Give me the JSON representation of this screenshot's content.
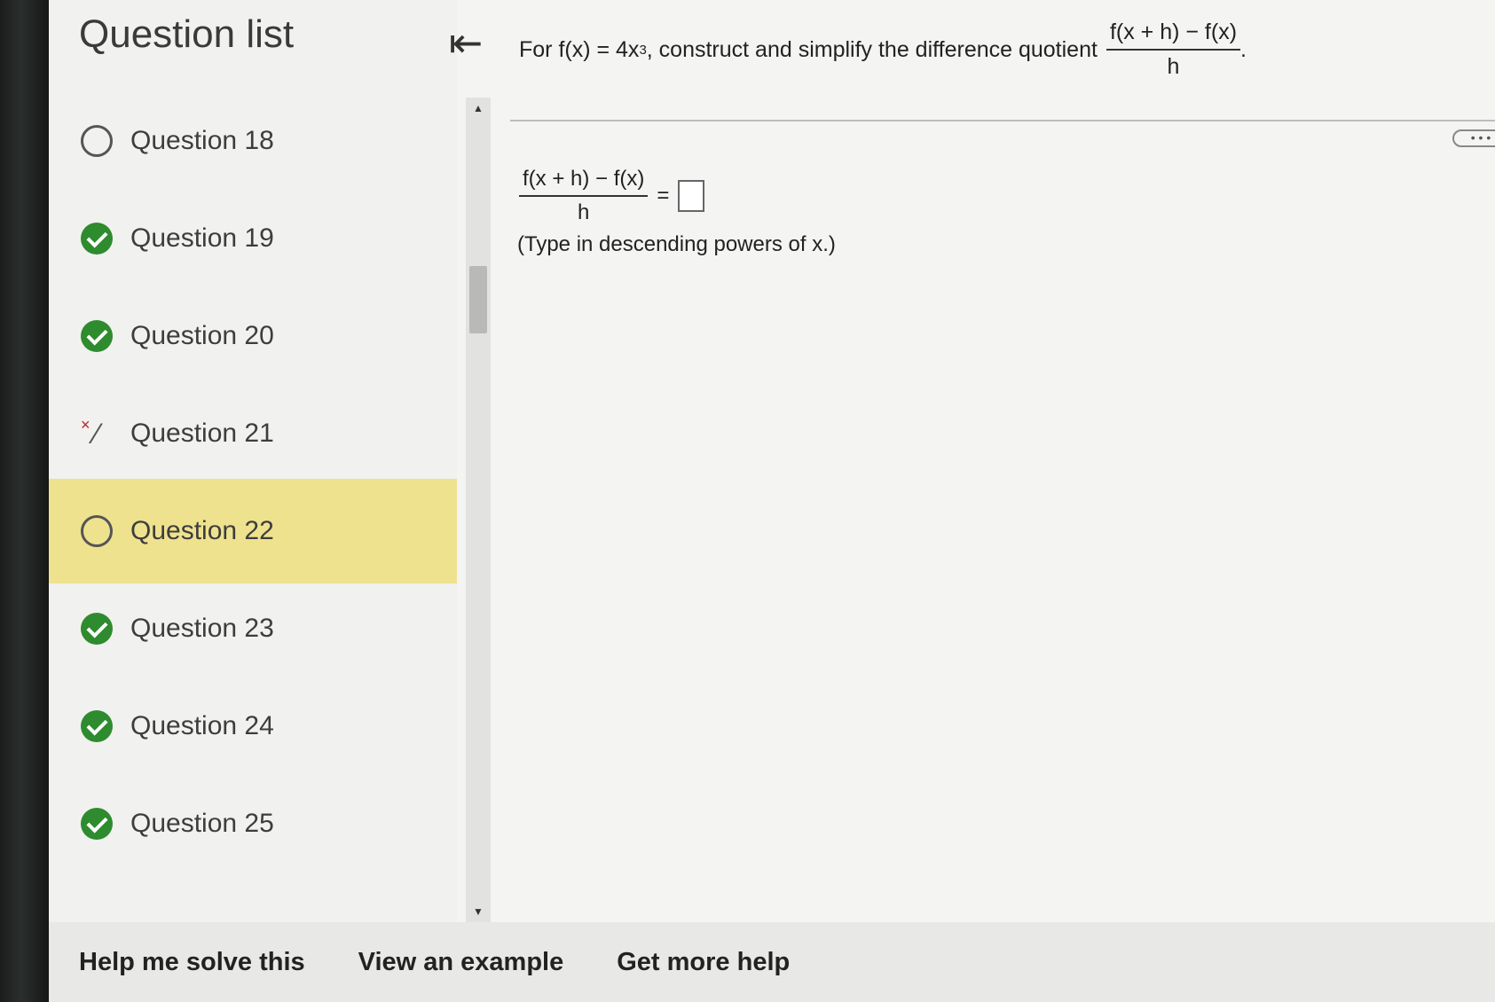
{
  "sidebar": {
    "title": "Question list",
    "collapse_icon": "collapse-left-icon",
    "items": [
      {
        "label": "Question 18",
        "status": "unanswered"
      },
      {
        "label": "Question 19",
        "status": "correct"
      },
      {
        "label": "Question 20",
        "status": "correct"
      },
      {
        "label": "Question 21",
        "status": "partial"
      },
      {
        "label": "Question 22",
        "status": "unanswered",
        "active": true
      },
      {
        "label": "Question 23",
        "status": "correct"
      },
      {
        "label": "Question 24",
        "status": "correct"
      },
      {
        "label": "Question 25",
        "status": "correct"
      }
    ]
  },
  "question": {
    "prompt_prefix": "For f(x) = 4x",
    "prompt_exponent": "3",
    "prompt_suffix": ", construct and simplify the difference quotient",
    "fraction_numerator": "f(x + h) − f(x)",
    "fraction_denominator": "h",
    "prompt_end": ".",
    "answer_equals": "=",
    "answer_value": "",
    "hint": "(Type in descending powers of x.)",
    "more_label": "• • •"
  },
  "bottom_bar": {
    "help": "Help me solve this",
    "example": "View an example",
    "more": "Get more help"
  },
  "colors": {
    "active_item": "#efe28f",
    "correct": "#2e8b2e"
  }
}
